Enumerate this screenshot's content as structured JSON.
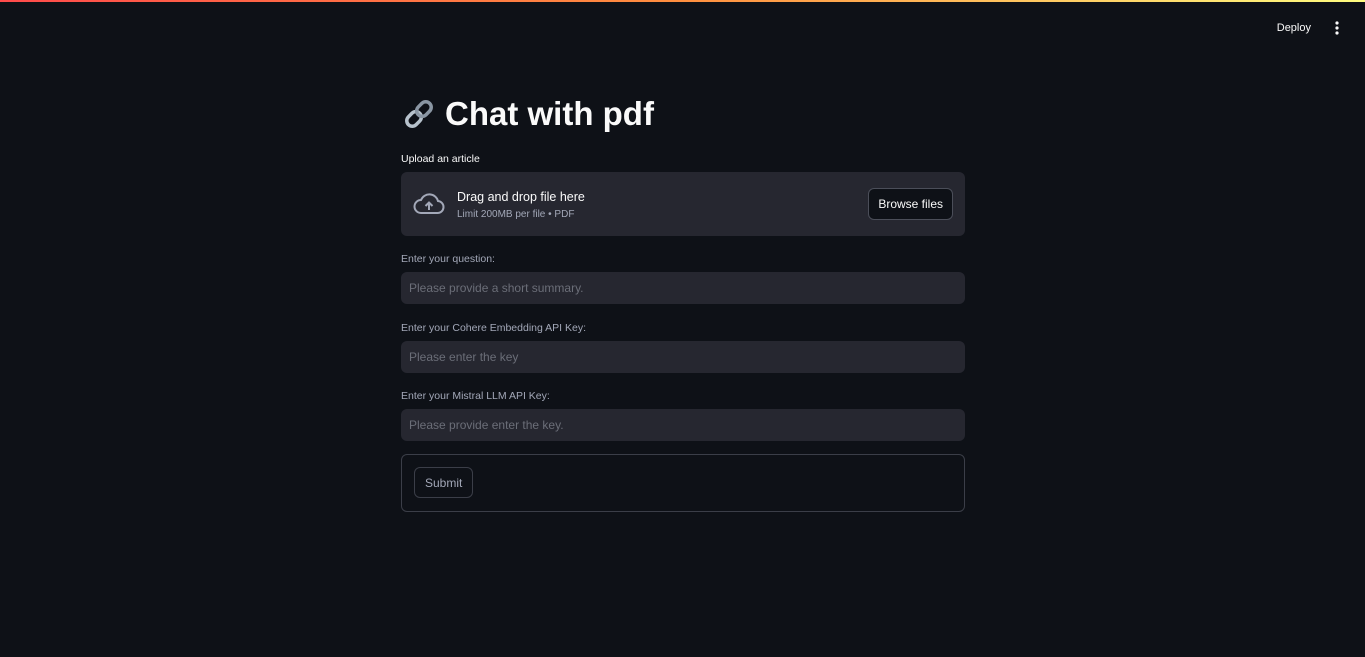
{
  "header": {
    "deploy_label": "Deploy",
    "menu_icon": "vertical-ellipsis-icon"
  },
  "main": {
    "title_icon": "link-icon",
    "title": "Chat with pdf",
    "uploader": {
      "label": "Upload an article",
      "drag_text": "Drag and drop file here",
      "limit_text": "Limit 200MB per file • PDF",
      "browse_label": "Browse files",
      "icon": "cloud-upload-icon"
    },
    "question": {
      "label": "Enter your question:",
      "placeholder": "Please provide a short summary.",
      "value": ""
    },
    "cohere_key": {
      "label": "Enter your Cohere Embedding API Key:",
      "placeholder": "Please enter the key",
      "value": ""
    },
    "mistral_key": {
      "label": "Enter your Mistral LLM API Key:",
      "placeholder": "Please provide enter the key.",
      "value": ""
    },
    "submit_label": "Submit"
  },
  "colors": {
    "background": "#0e1117",
    "input_background": "#262730",
    "accent_gradient_start": "#ff4b4b",
    "accent_gradient_end": "#fffd80"
  }
}
